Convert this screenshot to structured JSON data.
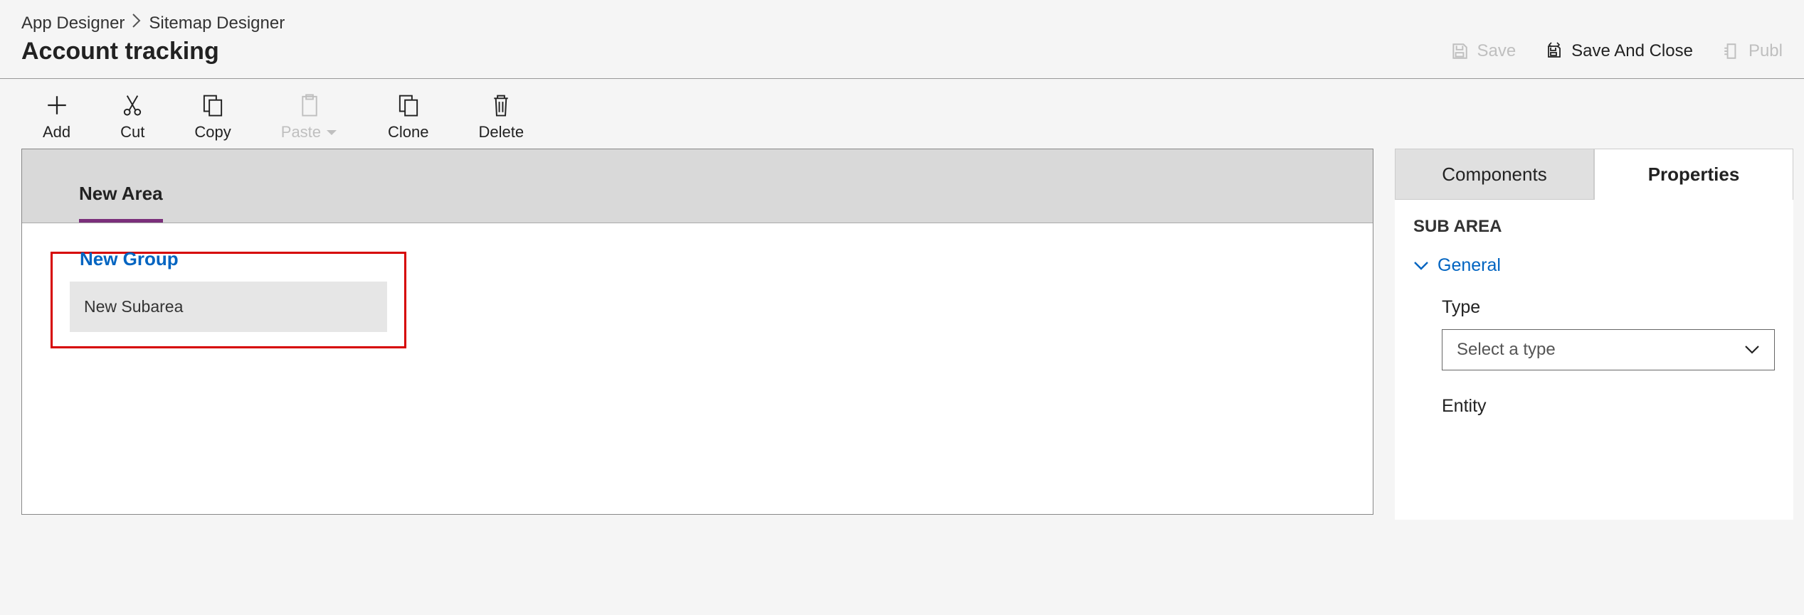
{
  "breadcrumb": {
    "item1": "App Designer",
    "item2": "Sitemap Designer"
  },
  "page_title": "Account tracking",
  "header_actions": {
    "save": "Save",
    "save_and_close": "Save And Close",
    "publish": "Publ"
  },
  "toolbar": {
    "add": "Add",
    "cut": "Cut",
    "copy": "Copy",
    "paste": "Paste",
    "clone": "Clone",
    "delete": "Delete"
  },
  "canvas": {
    "area_tab": "New Area",
    "group_title": "New Group",
    "subarea_label": "New Subarea"
  },
  "panel": {
    "tab_components": "Components",
    "tab_properties": "Properties",
    "heading": "SUB AREA",
    "section_general": "General",
    "field_type_label": "Type",
    "field_type_placeholder": "Select a type",
    "field_entity_label": "Entity"
  }
}
